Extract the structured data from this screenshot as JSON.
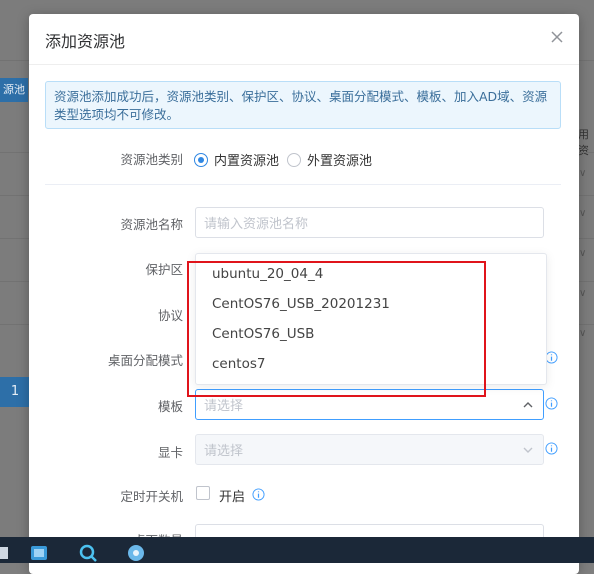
{
  "background": {
    "side_button": "源池",
    "page_number": "1",
    "column_hint": "用资"
  },
  "modal": {
    "title": "添加资源池",
    "notice": "资源池添加成功后，资源池类别、保护区、协议、桌面分配模式、模板、加入AD域、资源类型选项均不可修改。",
    "fields": {
      "pool_type": {
        "label": "资源池类别",
        "options": [
          "内置资源池",
          "外置资源池"
        ],
        "selected": "内置资源池"
      },
      "pool_name": {
        "label": "资源池名称",
        "placeholder": "请输入资源池名称"
      },
      "protect_zone": {
        "label": "保护区"
      },
      "protocol": {
        "label": "协议"
      },
      "desktop_mode": {
        "label": "桌面分配模式"
      },
      "template": {
        "label": "模板",
        "placeholder": "请选择"
      },
      "gpu": {
        "label": "显卡",
        "placeholder": "请选择"
      },
      "scheduled_power": {
        "label": "定时开关机",
        "checkbox_text": "开启"
      },
      "desktop_count": {
        "label": "桌面数量"
      }
    },
    "template_dropdown": {
      "options": [
        "ubuntu_20_04_4",
        "CentOS76_USB_20201231",
        "CentOS76_USB",
        "centos7"
      ]
    }
  },
  "colors": {
    "primary": "#2f87e3",
    "highlight_box": "#e0141b",
    "notice_bg": "#ecf6fd"
  }
}
